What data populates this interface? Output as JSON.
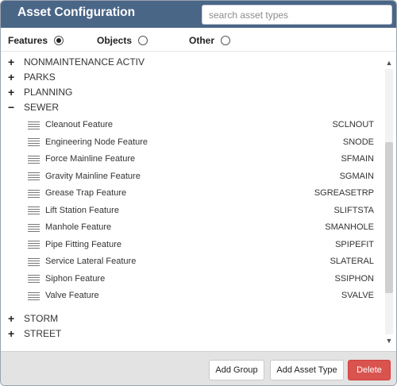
{
  "header": {
    "title": "Asset Configuration",
    "search_placeholder": "search asset types"
  },
  "filters": {
    "features_label": "Features",
    "objects_label": "Objects",
    "other_label": "Other",
    "selected": "Features"
  },
  "tree": {
    "groups_top": [
      {
        "toggle": "+",
        "label": "NONMAINTENANCE ACTIV"
      },
      {
        "toggle": "+",
        "label": "PARKS"
      },
      {
        "toggle": "+",
        "label": "PLANNING"
      },
      {
        "toggle": "−",
        "label": "SEWER"
      }
    ],
    "sewer_items": [
      {
        "name": "Cleanout Feature",
        "code": "SCLNOUT"
      },
      {
        "name": "Engineering Node Feature",
        "code": "SNODE"
      },
      {
        "name": "Force Mainline Feature",
        "code": "SFMAIN"
      },
      {
        "name": "Gravity Mainline Feature",
        "code": "SGMAIN"
      },
      {
        "name": "Grease Trap Feature",
        "code": "SGREASETRP"
      },
      {
        "name": "Lift Station Feature",
        "code": "SLIFTSTA"
      },
      {
        "name": "Manhole Feature",
        "code": "SMANHOLE"
      },
      {
        "name": "Pipe Fitting Feature",
        "code": "SPIPEFIT"
      },
      {
        "name": "Service Lateral Feature",
        "code": "SLATERAL"
      },
      {
        "name": "Siphon Feature",
        "code": "SSIPHON"
      },
      {
        "name": "Valve Feature",
        "code": "SVALVE"
      }
    ],
    "groups_bottom": [
      {
        "toggle": "+",
        "label": "STORM"
      },
      {
        "toggle": "+",
        "label": "STREET"
      }
    ]
  },
  "footer": {
    "add_group_label": "Add Group",
    "add_asset_type_label": "Add Asset Type",
    "delete_label": "Delete"
  },
  "colors": {
    "header_bg": "#4a6687",
    "delete_bg": "#d9534f"
  }
}
